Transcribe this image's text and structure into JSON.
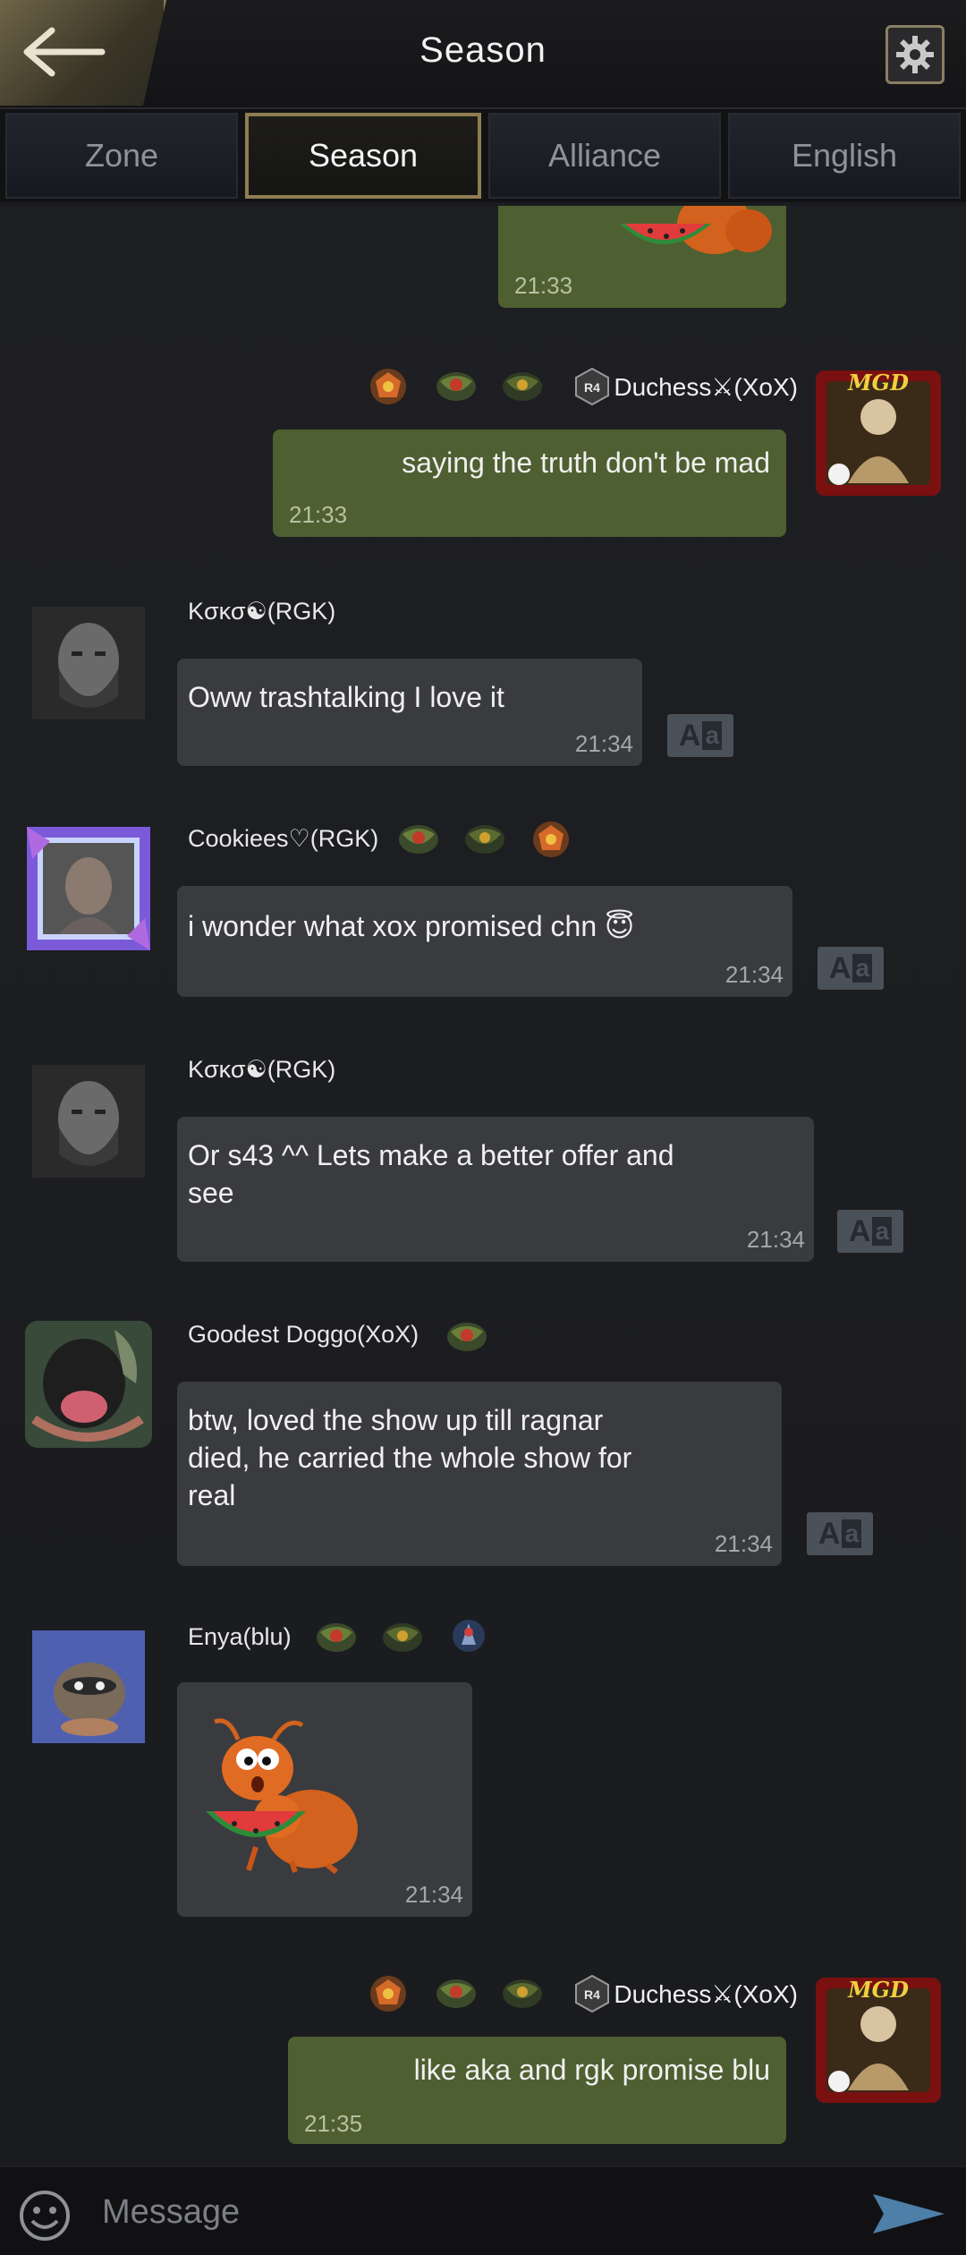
{
  "header": {
    "title": "Season"
  },
  "tabs": [
    {
      "label": "Zone",
      "active": false
    },
    {
      "label": "Season",
      "active": true
    },
    {
      "label": "Alliance",
      "active": false
    },
    {
      "label": "English",
      "active": false
    }
  ],
  "messages": [
    {
      "sender": "",
      "time": "21:33",
      "type": "sticker-partial",
      "outgoing": true
    },
    {
      "sender": "Duchess⚔(XoX)",
      "rank": "R4",
      "text": "saying the truth don't be mad",
      "time": "21:33",
      "outgoing": true
    },
    {
      "sender": "Kσκσ☯(RGK)",
      "text": "Oww trashtalking I love it",
      "time": "21:34",
      "outgoing": false
    },
    {
      "sender": "Cookiees♡(RGK)",
      "text": "i wonder what xox promised chn 😇",
      "time": "21:34",
      "outgoing": false
    },
    {
      "sender": "Kσκσ☯(RGK)",
      "text": "Or s43 ^^ Lets make a better offer and\n see",
      "time": "21:34",
      "outgoing": false
    },
    {
      "sender": "Goodest Doggo(XoX)",
      "text": "btw, loved the show up till ragnar\ndied, he carried the whole show for\nreal",
      "time": "21:34",
      "outgoing": false
    },
    {
      "sender": "Enya(blu)",
      "time": "21:34",
      "type": "sticker",
      "outgoing": false
    },
    {
      "sender": "Duchess⚔(XoX)",
      "rank": "R4",
      "text": "like aka and rgk promise blu",
      "time": "21:35",
      "outgoing": true
    }
  ],
  "input": {
    "placeholder": "Message"
  },
  "colors": {
    "accent_gold": "#8f7d52",
    "outgoing_bubble": "#4e5f31",
    "incoming_bubble": "#3a3b3f",
    "background": "#1b1c1f"
  }
}
